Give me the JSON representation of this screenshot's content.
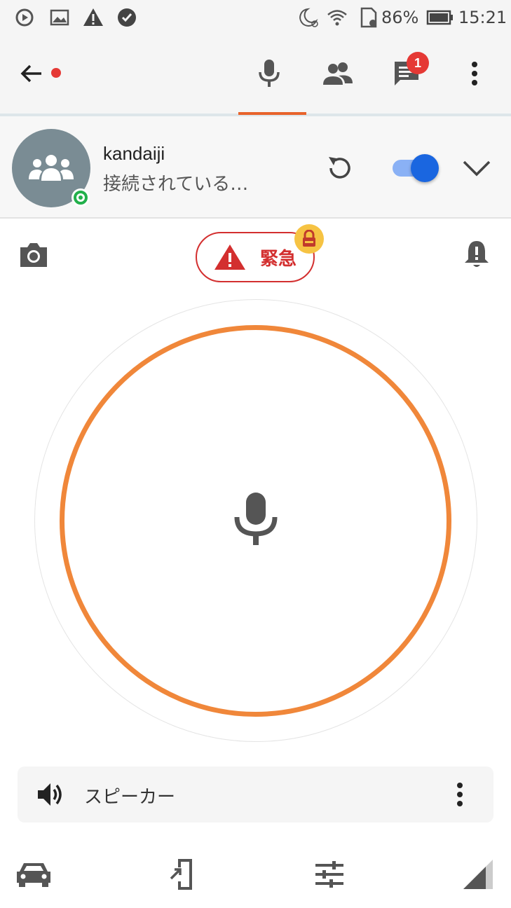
{
  "status_bar": {
    "battery_percent": "86%",
    "time": "15:21",
    "icons": [
      "sync-play-icon",
      "image-icon",
      "warning-icon",
      "check-shield-icon",
      "moon-alarm-icon",
      "wifi-icon",
      "sd-card-icon",
      "battery-icon"
    ]
  },
  "top_bar": {
    "icons": [
      "back-arrow-icon",
      "mic-icon",
      "people-icon",
      "chat-icon",
      "more-vert-icon"
    ],
    "chat_badge_count": "1",
    "accent_color": "#e8632b"
  },
  "channel": {
    "name": "kandaiji",
    "status": "接続されている…",
    "online_color": "#22b04b",
    "toggle_on": true
  },
  "actions": {
    "emergency_label": "緊急",
    "emergency_color": "#d32f2f"
  },
  "ptt": {
    "ring_color": "#f0873a"
  },
  "speaker": {
    "label": "スピーカー"
  },
  "bottom_nav": {
    "icons": [
      "car-icon",
      "phone-login-icon",
      "tune-icon",
      "signal-icon"
    ]
  }
}
